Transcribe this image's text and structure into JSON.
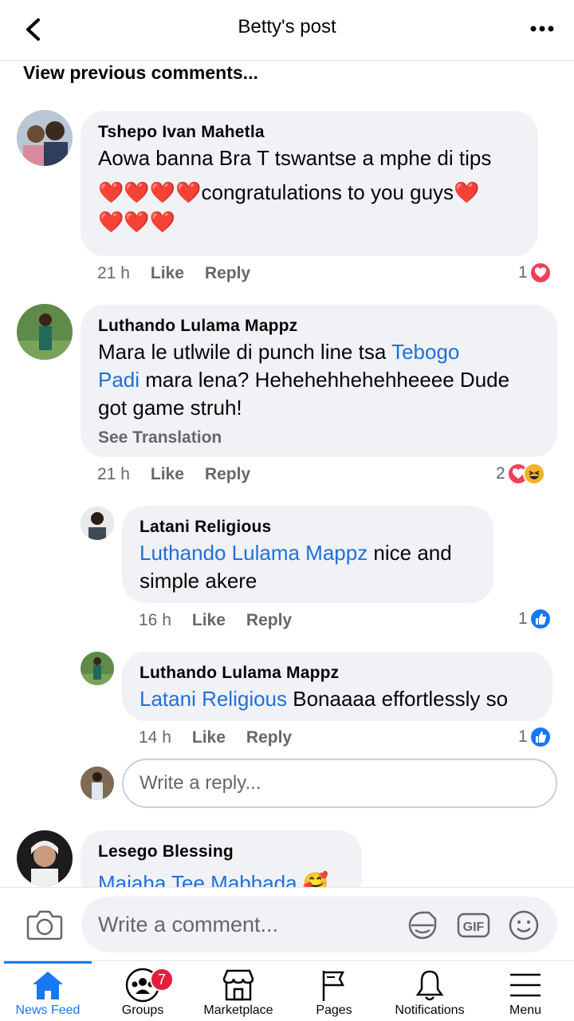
{
  "header": {
    "title": "Betty's post"
  },
  "view_previous": "View previous comments...",
  "comments": [
    {
      "author": "Tshepo Ivan Mahetla",
      "line1": "Aowa banna Bra T tswantse a mphe di tips",
      "line2_suffix": "congratulations to you guys",
      "time": "21 h",
      "like": "Like",
      "reply": "Reply",
      "reaction_count": "1",
      "reactions": [
        "love"
      ]
    },
    {
      "author": "Luthando Lulama Mappz",
      "text_before": "Mara le utlwile di punch line tsa ",
      "mention1": "Tebogo",
      "mention2": "Padi",
      "text_after": " mara lena? Hehehehhehehheeee Dude",
      "line3": "got game struh!",
      "see_translation": "See Translation",
      "time": "21 h",
      "like": "Like",
      "reply": "Reply",
      "reaction_count": "2",
      "reactions": [
        "love",
        "haha"
      ]
    },
    {
      "author": "Latani Religious",
      "mention": "Luthando Lulama Mappz",
      "text": " nice and",
      "line2": "simple akere",
      "time": "16 h",
      "like": "Like",
      "reply": "Reply",
      "reaction_count": "1",
      "reactions": [
        "like"
      ]
    },
    {
      "author": "Luthando Lulama Mappz",
      "mention": "Latani Religious",
      "text": " Bonaaaa effortlessly so",
      "time": "14 h",
      "like": "Like",
      "reply": "Reply",
      "reaction_count": "1",
      "reactions": [
        "like"
      ]
    },
    {
      "author": "Lesego Blessing",
      "mention": "Majaha Tee Mabhada"
    }
  ],
  "reply_input": {
    "placeholder": "Write a reply..."
  },
  "comment_input": {
    "placeholder": "Write a comment...",
    "gif_label": "GIF"
  },
  "tabs": [
    {
      "label": "News Feed",
      "icon": "home-icon",
      "active": true
    },
    {
      "label": "Groups",
      "icon": "groups-icon",
      "badge": "7"
    },
    {
      "label": "Marketplace",
      "icon": "marketplace-icon"
    },
    {
      "label": "Pages",
      "icon": "flag-icon"
    },
    {
      "label": "Notifications",
      "icon": "bell-icon"
    },
    {
      "label": "Menu",
      "icon": "menu-icon"
    }
  ],
  "colors": {
    "accent": "#1877f2",
    "link": "#216fdb",
    "bubble": "#f0f2f5",
    "secondary_text": "#65676b",
    "badge": "#e41e3f"
  }
}
